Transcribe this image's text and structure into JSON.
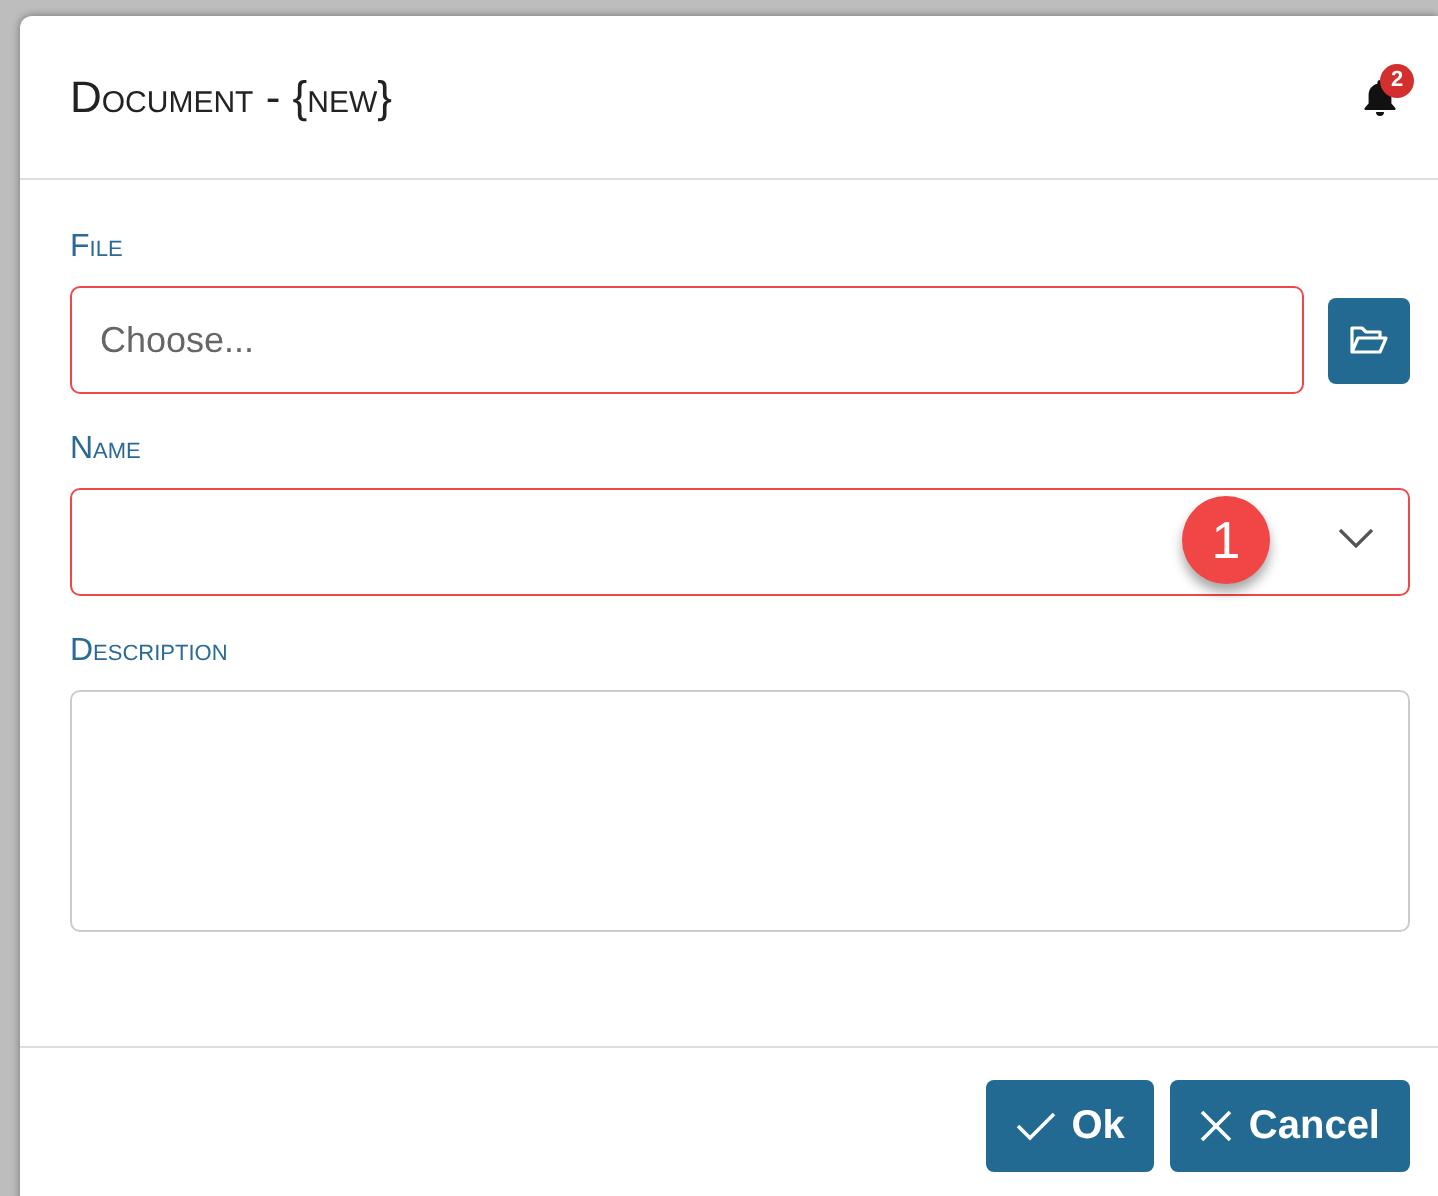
{
  "dialog": {
    "title": "Document - {new}",
    "notification_count": "2"
  },
  "fields": [
    {
      "kind": "file",
      "label": "File",
      "placeholder": "Choose...",
      "invalid": true
    },
    {
      "kind": "select",
      "label": "Name",
      "invalid": true,
      "badge": "1"
    },
    {
      "kind": "textarea",
      "label": "Description",
      "invalid": false
    }
  ],
  "buttons": [
    {
      "kind": "ok",
      "label": "Ok"
    },
    {
      "kind": "cancel",
      "label": "Cancel"
    }
  ]
}
